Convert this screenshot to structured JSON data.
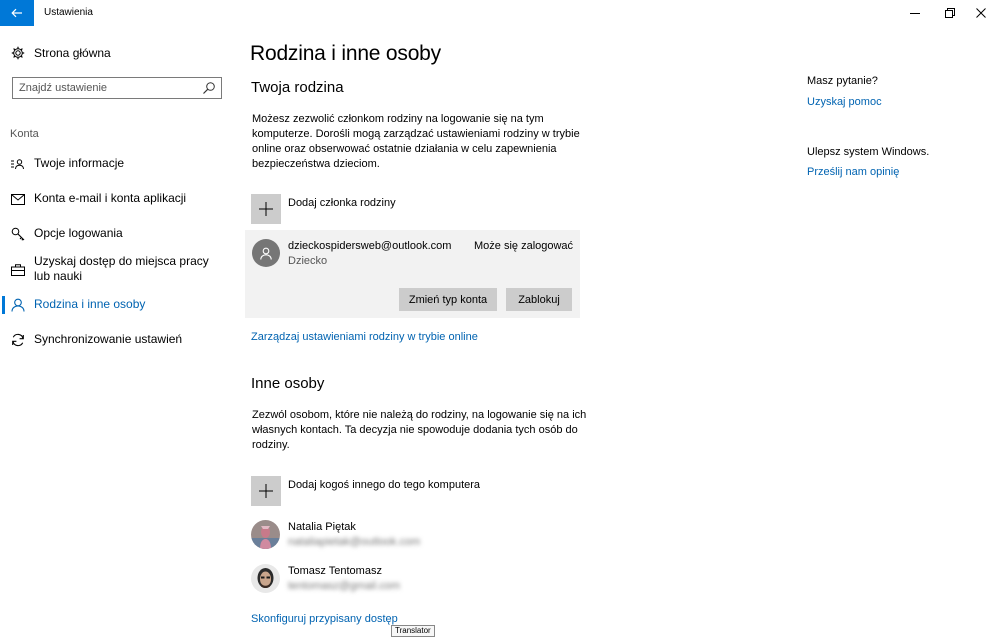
{
  "window": {
    "title": "Ustawienia",
    "accent": "#0078d7"
  },
  "sidebar": {
    "home_label": "Strona główna",
    "search_placeholder": "Znajdź ustawienie",
    "section_label": "Konta",
    "items": [
      {
        "label": "Twoje informacje",
        "icon": "person-card-icon"
      },
      {
        "label": "Konta e-mail i konta aplikacji",
        "icon": "mail-icon"
      },
      {
        "label": "Opcje logowania",
        "icon": "key-icon"
      },
      {
        "label": "Uzyskaj dostęp do miejsca pracy lub nauki",
        "icon": "briefcase-icon"
      },
      {
        "label": "Rodzina i inne osoby",
        "icon": "person-icon",
        "active": true
      },
      {
        "label": "Synchronizowanie ustawień",
        "icon": "sync-icon"
      }
    ]
  },
  "main": {
    "page_title": "Rodzina i inne osoby",
    "family": {
      "heading": "Twoja rodzina",
      "description": "Możesz zezwolić członkom rodziny na logowanie się na tym komputerze. Dorośli mogą zarządzać ustawieniami rodziny w trybie online oraz obserwować ostatnie działania w celu zapewnienia bezpieczeństwa dzieciom.",
      "add_label": "Dodaj członka rodziny",
      "member": {
        "email": "dzieckospidersweb@outlook.com",
        "role": "Dziecko",
        "status": "Może się zalogować",
        "change_button": "Zmień typ konta",
        "block_button": "Zablokuj"
      },
      "manage_link": "Zarządzaj ustawieniami rodziny w trybie online"
    },
    "others": {
      "heading": "Inne osoby",
      "description": "Zezwól osobom, które nie należą do rodziny, na logowanie się na ich własnych kontach. Ta decyzja nie spowoduje dodania tych osób do rodziny.",
      "add_label": "Dodaj kogoś innego do tego komputera",
      "people": [
        {
          "name": "Natalia Piętak",
          "email": "nataliapietak@outlook.com"
        },
        {
          "name": "Tomasz Tentomasz",
          "email": "tentomasz@gmail.com"
        }
      ],
      "assigned_access_link": "Skonfiguruj przypisany dostęp"
    }
  },
  "aside": {
    "question": "Masz pytanie?",
    "help_link": "Uzyskaj pomoc",
    "improve": "Ulepsz system Windows.",
    "feedback_link": "Prześlij nam opinię"
  },
  "tooltip": "Translator"
}
